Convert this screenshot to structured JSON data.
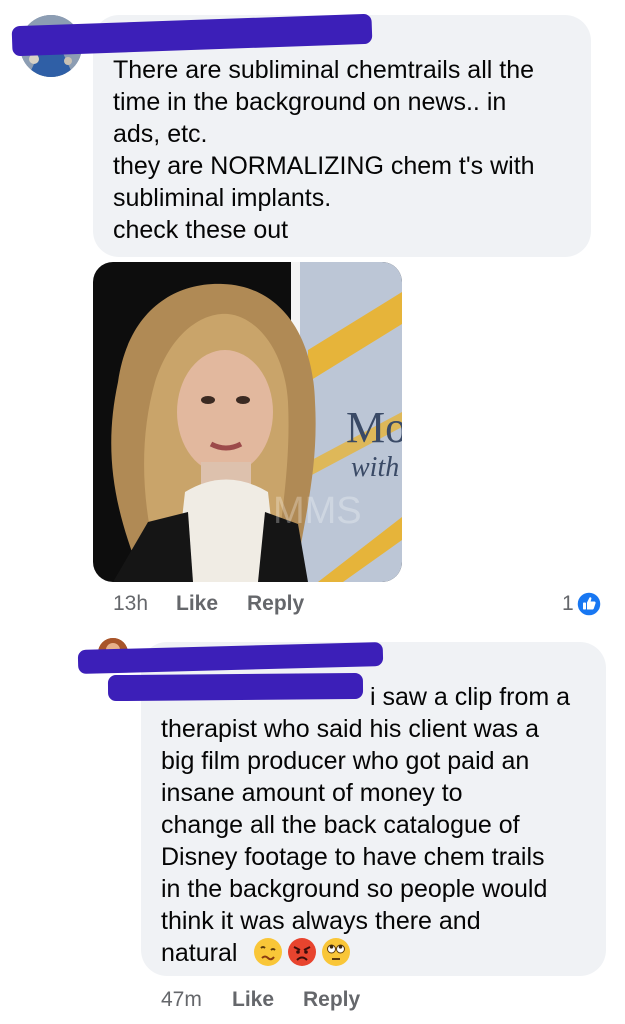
{
  "comments": [
    {
      "author_redacted": true,
      "text": "There are subliminal chemtrails all the\ntime in the background on news.. in\nads, etc.\nthey are NORMALIZING chem t's with\nsubliminal implants.\ncheck these out",
      "attachment": {
        "type": "image",
        "visible_text_line1": "Mo",
        "visible_text_line2": "with",
        "watermark": "MMS"
      },
      "time": "13h",
      "like_label": "Like",
      "reply_label": "Reply",
      "reaction_count": "1",
      "reaction_icon": "like-thumb-icon"
    },
    {
      "author_redacted": true,
      "text_line1": "i saw a clip from a",
      "text_rest": "therapist who said his client was a\nbig film producer who got paid an\ninsane amount of money to\nchange all the back catalogue of\nDisney footage to have chem trails\nin the background so people would\nthink it was always there and\nnatural",
      "emojis": [
        "woozy-face-icon",
        "angry-face-icon",
        "eye-roll-face-icon"
      ],
      "time": "47m",
      "like_label": "Like",
      "reply_label": "Reply"
    }
  ],
  "colors": {
    "bubble": "#f0f2f5",
    "redaction": "#3c1fb8",
    "like_blue": "#1877f2",
    "meta_gray": "#65676b"
  }
}
